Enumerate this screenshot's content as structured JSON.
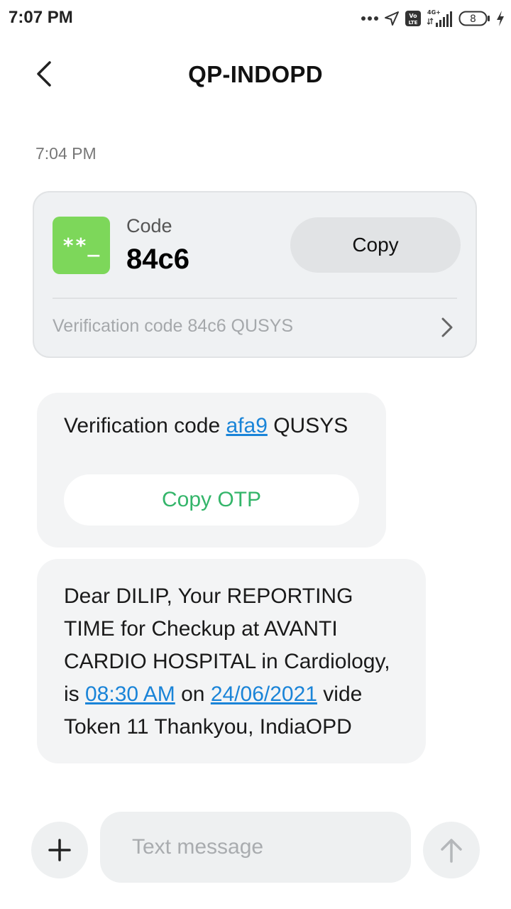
{
  "status_bar": {
    "time": "7:07 PM",
    "network": "4G+",
    "volte": "Vo LTE",
    "battery": "8",
    "icons": [
      "more-dots-icon",
      "location-arrow-icon",
      "volte-icon",
      "signal-icon",
      "battery-icon",
      "charging-bolt-icon"
    ]
  },
  "header": {
    "title": "QP-INDOPD",
    "back_icon": "chevron-left-icon"
  },
  "conversation": {
    "timestamp": "7:04 PM",
    "otp_card": {
      "tile_text": "**_",
      "label": "Code",
      "code": "84c6",
      "copy_label": "Copy",
      "preview": "Verification code 84c6 QUSYS",
      "tile_color": "#7dd75a"
    },
    "message_1": {
      "text_before": "Verification code ",
      "link": "afa9",
      "text_after": " QUSYS",
      "copy_otp_label": "Copy OTP"
    },
    "message_2": {
      "line1": "Dear DILIP, Your REPORTING",
      "line2": "TIME for Checkup at AVANTI",
      "line3": "CARDIO HOSPITAL in Cardiology,",
      "line4_before": "is ",
      "time_link": "08:30 AM",
      "line4_mid": " on ",
      "date_link": "24/06/2021",
      "line4_after": " vide",
      "line5": "Token 11 Thankyou, IndiaOPD"
    }
  },
  "composer": {
    "placeholder": "Text message",
    "value": "",
    "plus_icon": "plus-icon",
    "send_icon": "send-arrow-icon"
  },
  "colors": {
    "link": "#1a84d8",
    "copy_otp": "#34b56a",
    "bubble": "#f3f4f5"
  }
}
